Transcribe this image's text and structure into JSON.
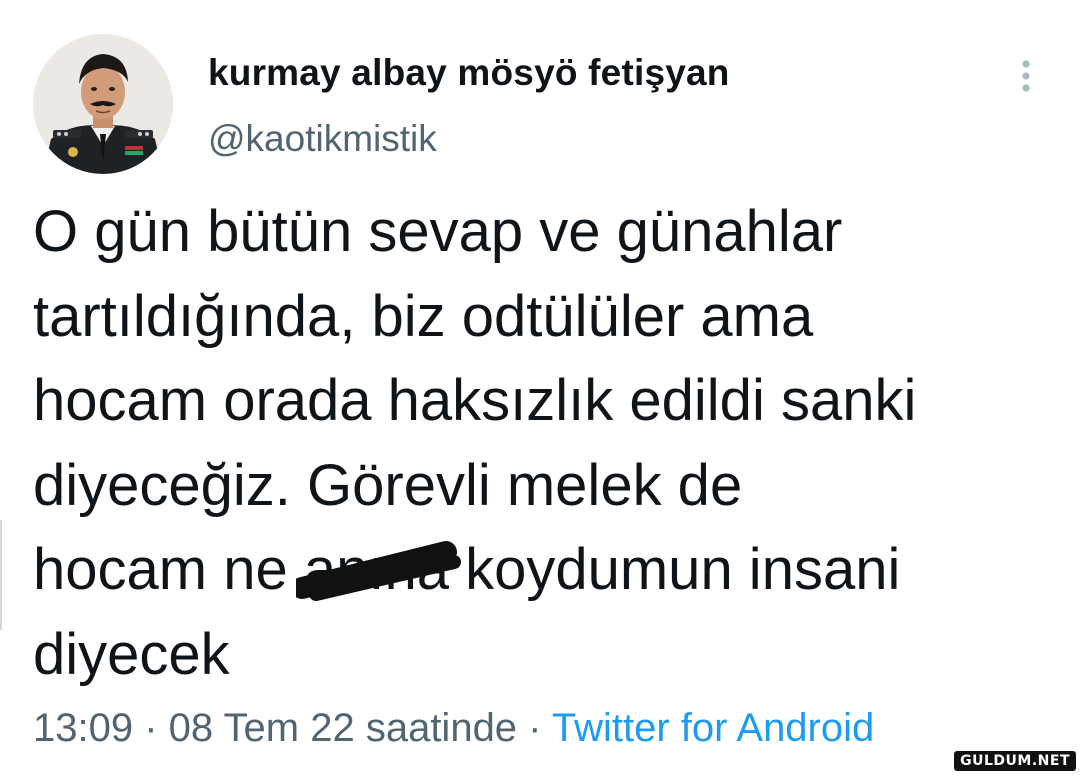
{
  "author": {
    "display_name": "kurmay albay mösyö fetişyan",
    "handle": "@kaotikmistik",
    "avatar_icon": "profile-photo"
  },
  "tweet": {
    "lines": [
      "O gün bütün sevap ve günahlar",
      "tartıldığında, biz odtülüler ama",
      "hocam orada haksızlık edildi sanki",
      "diyeceğiz. Görevli melek de"
    ],
    "line5_before": "hocam ne ",
    "line5_censored": "anına",
    "line5_after": " koydumun insani",
    "line6": "diyecek"
  },
  "meta": {
    "time": "13:09",
    "separator": " · ",
    "date": "08 Tem 22 saatinde",
    "separator2": " · ",
    "source": "Twitter for Android"
  },
  "more_icon": "vertical-dots-icon",
  "watermark": "GULDUM.NET",
  "colors": {
    "text": "#0f1419",
    "secondary": "#536471",
    "link": "#1d9bf0"
  }
}
